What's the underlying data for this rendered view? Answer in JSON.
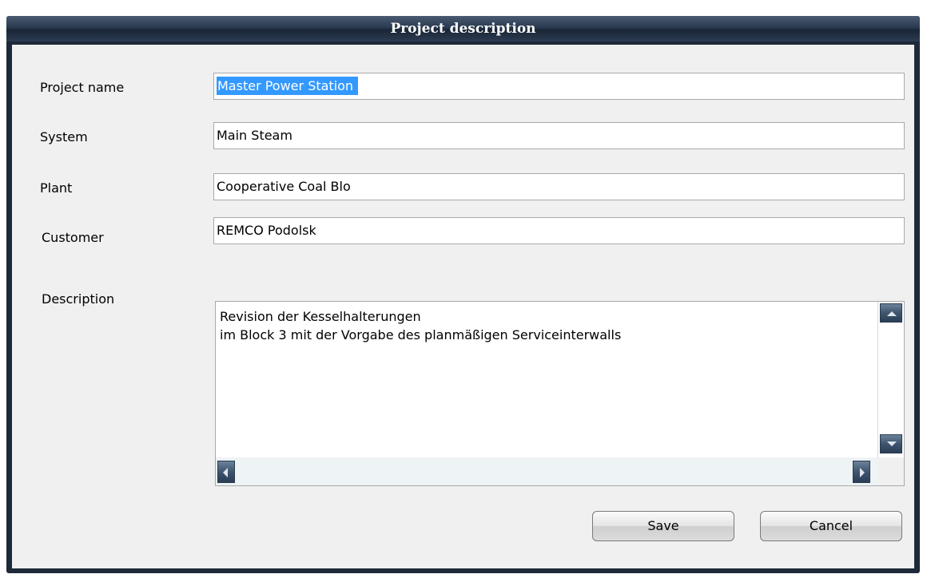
{
  "dialog": {
    "title": "Project description"
  },
  "form": {
    "project_name": {
      "label": "Project name",
      "value": "Master Power Station "
    },
    "system": {
      "label": "System",
      "value": "Main Steam"
    },
    "plant": {
      "label": "Plant",
      "value": "Cooperative Coal Blo"
    },
    "customer": {
      "label": "Customer",
      "value": "REMCO Podolsk"
    },
    "description": {
      "label": "Description",
      "lines": [
        "Revision der Kesselhalterungen",
        "im Block 3 mit der Vorgabe des planmäßigen Serviceinterwalls"
      ]
    }
  },
  "buttons": {
    "save": "Save",
    "cancel": "Cancel"
  },
  "icons": {
    "scroll_up": "scroll-up-arrow-icon",
    "scroll_down": "scroll-down-arrow-icon",
    "scroll_left": "scroll-left-arrow-icon",
    "scroll_right": "scroll-right-arrow-icon"
  },
  "colors": {
    "title_bar": "#2a3a50",
    "selection": "#3399ff",
    "client_background": "#f0f0f0"
  }
}
